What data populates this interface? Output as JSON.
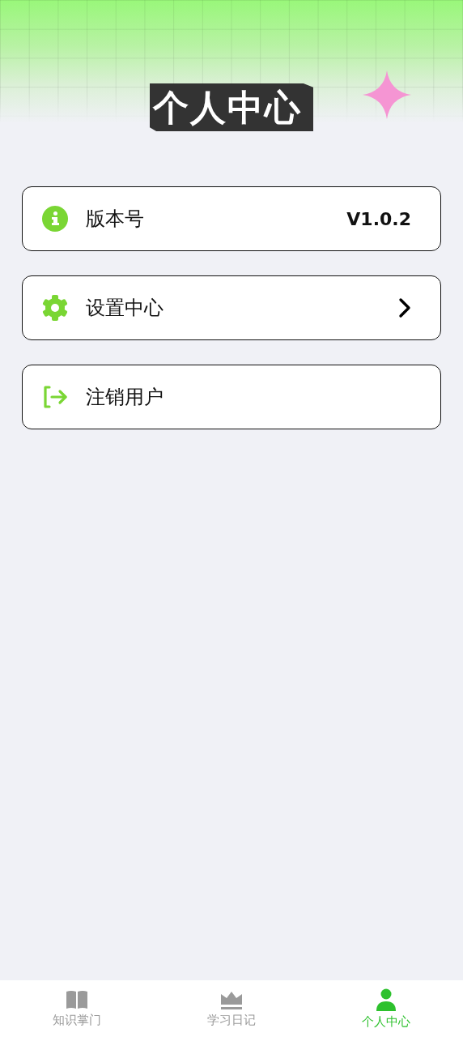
{
  "header": {
    "title": "个人中心"
  },
  "items": [
    {
      "kind": "info",
      "label": "版本号",
      "value": "V1.0.2"
    },
    {
      "kind": "settings",
      "label": "设置中心"
    },
    {
      "kind": "logout",
      "label": "注销用户"
    }
  ],
  "tabs": [
    {
      "kind": "book",
      "label": "知识掌门",
      "selected": false
    },
    {
      "kind": "crown",
      "label": "学习日记",
      "selected": false
    },
    {
      "kind": "person",
      "label": "个人中心",
      "selected": true
    }
  ]
}
